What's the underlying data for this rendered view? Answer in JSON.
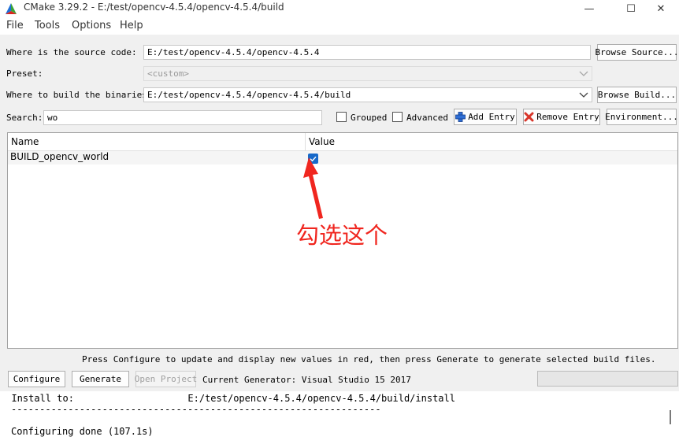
{
  "window": {
    "title": "CMake 3.29.2 - E:/test/opencv-4.5.4/opencv-4.5.4/build",
    "minimize": "—",
    "maximize": "☐",
    "close": "✕"
  },
  "menu": {
    "items": [
      "File",
      "Tools",
      "Options",
      "Help"
    ]
  },
  "source": {
    "label": "Where is the source code:",
    "value": "E:/test/opencv-4.5.4/opencv-4.5.4",
    "browse_label": "Browse Source..."
  },
  "preset": {
    "label": "Preset:",
    "value": "<custom>"
  },
  "binaries": {
    "label": "Where to build the binaries:",
    "value": "E:/test/opencv-4.5.4/opencv-4.5.4/build",
    "browse_label": "Browse Build..."
  },
  "search": {
    "label": "Search:",
    "value": "wo"
  },
  "toolbar": {
    "grouped_label": "Grouped",
    "grouped_checked": false,
    "advanced_label": "Advanced",
    "advanced_checked": false,
    "add_entry_label": "Add Entry",
    "remove_entry_label": "Remove Entry",
    "environment_label": "Environment..."
  },
  "table": {
    "columns": [
      "Name",
      "Value"
    ],
    "rows": [
      {
        "name": "BUILD_opencv_world",
        "checked": true
      }
    ]
  },
  "annotation": {
    "text": "勾选这个",
    "color": "#f0261f"
  },
  "hint": "Press Configure to update and display new values in red, then press Generate to generate selected build files.",
  "actions": {
    "configure_label": "Configure",
    "generate_label": "Generate",
    "open_project_label": "Open Project",
    "generator_text": "Current Generator: Visual Studio 15 2017"
  },
  "log": {
    "lines": [
      "  Install to:                    E:/test/opencv-4.5.4/opencv-4.5.4/build/install",
      "-----------------------------------------------------------------",
      "",
      "Configuring done (107.1s)"
    ]
  },
  "colors": {
    "accent": "#1769c9",
    "annotation": "#f0261f"
  }
}
